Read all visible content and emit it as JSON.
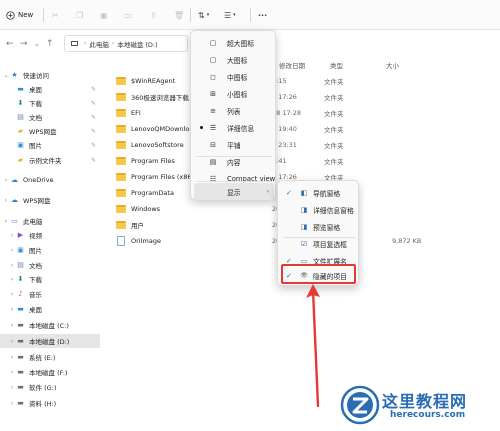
{
  "toolbar": {
    "new_label": "New",
    "more_label": "···"
  },
  "address": {
    "segments": [
      "此电脑",
      "本地磁盘 (D:)"
    ]
  },
  "sidebar": {
    "items": [
      {
        "label": "快速访问",
        "icon": "star-icon",
        "pinned": false
      },
      {
        "label": "桌面",
        "icon": "desktop-icon",
        "pinned": true
      },
      {
        "label": "下载",
        "icon": "download-icon",
        "pinned": true
      },
      {
        "label": "文档",
        "icon": "document-icon",
        "pinned": true
      },
      {
        "label": "WPS网盘",
        "icon": "folder-icon",
        "pinned": true
      },
      {
        "label": "图片",
        "icon": "picture-icon",
        "pinned": true
      },
      {
        "label": "示例文件夹",
        "icon": "folder-icon",
        "pinned": true
      },
      {
        "label": "OneDrive",
        "icon": "cloud-icon",
        "pinned": false
      },
      {
        "label": "WPS网盘",
        "icon": "cloud-icon",
        "pinned": false
      },
      {
        "label": "此电脑",
        "icon": "pc-icon",
        "pinned": false
      },
      {
        "label": "视频",
        "icon": "video-icon",
        "pinned": false
      },
      {
        "label": "图片",
        "icon": "picture-icon",
        "pinned": false
      },
      {
        "label": "文档",
        "icon": "document-icon",
        "pinned": false
      },
      {
        "label": "下载",
        "icon": "download-icon",
        "pinned": false
      },
      {
        "label": "音乐",
        "icon": "music-icon",
        "pinned": false
      },
      {
        "label": "桌面",
        "icon": "desktop-icon",
        "pinned": false
      },
      {
        "label": "本地磁盘 (C:)",
        "icon": "drive-icon",
        "pinned": false
      },
      {
        "label": "本地磁盘 (D:)",
        "icon": "drive-icon",
        "pinned": false,
        "selected": true
      },
      {
        "label": "系统 (E:)",
        "icon": "drive-icon",
        "pinned": false
      },
      {
        "label": "本地磁盘 (F:)",
        "icon": "drive-icon",
        "pinned": false
      },
      {
        "label": "软件 (G:)",
        "icon": "drive-icon",
        "pinned": false
      },
      {
        "label": "资料 (H:)",
        "icon": "drive-icon",
        "pinned": false
      }
    ]
  },
  "filelist": {
    "headers": {
      "date": "修改日期",
      "type": "类型",
      "size": "大小"
    },
    "rows": [
      {
        "name": "$WinREAgent",
        "kind": "folder",
        "date": "2:15",
        "type": "文件夹",
        "size": ""
      },
      {
        "name": "360极速浏览器下载",
        "kind": "folder",
        "date": "2 17:26",
        "type": "文件夹",
        "size": ""
      },
      {
        "name": "EFI",
        "kind": "folder",
        "date": "28 17:28",
        "type": "文件夹",
        "size": ""
      },
      {
        "name": "LenovoQMDownload",
        "kind": "folder",
        "date": "6 19:40",
        "type": "文件夹",
        "size": ""
      },
      {
        "name": "LenovoSoftstore",
        "kind": "folder",
        "date": "6 23:31",
        "type": "文件夹",
        "size": ""
      },
      {
        "name": "Program Files",
        "kind": "folder",
        "date": "2:41",
        "type": "文件夹",
        "size": ""
      },
      {
        "name": "Program Files (x86)",
        "kind": "folder",
        "date": "2 17:26",
        "type": "文件夹",
        "size": ""
      },
      {
        "name": "ProgramData",
        "kind": "folder",
        "date": "",
        "type": "文件夹",
        "size": ""
      },
      {
        "name": "Windows",
        "kind": "folder",
        "date": "2021/4/",
        "type": "文件夹",
        "size": ""
      },
      {
        "name": "用户",
        "kind": "folder",
        "date": "2021/6/",
        "type": "文件夹",
        "size": ""
      },
      {
        "name": "OriImage",
        "kind": "file",
        "date": "2021/6/",
        "type": "文件",
        "size": "9,872 KB"
      }
    ]
  },
  "view_menu": {
    "items": [
      {
        "label": "超大图标",
        "icon": "square-icon"
      },
      {
        "label": "大图标",
        "icon": "square-icon"
      },
      {
        "label": "中图标",
        "icon": "medium-icons-icon"
      },
      {
        "label": "小图标",
        "icon": "small-icons-icon"
      },
      {
        "label": "列表",
        "icon": "list-icon"
      },
      {
        "label": "详细信息",
        "icon": "details-icon",
        "selected": true
      },
      {
        "label": "平铺",
        "icon": "tiles-icon"
      },
      {
        "label": "内容",
        "icon": "content-icon"
      },
      {
        "label": "Compact view",
        "icon": "compact-view-icon"
      },
      {
        "label": "显示",
        "icon": "",
        "submenu": true
      }
    ]
  },
  "show_submenu": {
    "items": [
      {
        "label": "导航窗格",
        "icon": "nav-pane-icon",
        "checked": true
      },
      {
        "label": "详细信息窗格",
        "icon": "details-pane-icon",
        "checked": false
      },
      {
        "label": "预览窗格",
        "icon": "preview-pane-icon",
        "checked": false
      },
      {
        "label": "项目复选框",
        "icon": "checkbox-icon",
        "checked": false
      },
      {
        "label": "文件扩展名",
        "icon": "file-ext-icon",
        "checked": true
      },
      {
        "label": "隐藏的项目",
        "icon": "eye-icon",
        "checked": true,
        "highlighted": true
      }
    ]
  },
  "watermark": {
    "cn": "这里教程网",
    "en": "herecours.com"
  },
  "colors": {
    "accent": "#2b6cb0",
    "highlight": "#e53935",
    "watermark": "#2a6db5",
    "folder": "#f6c94a"
  }
}
